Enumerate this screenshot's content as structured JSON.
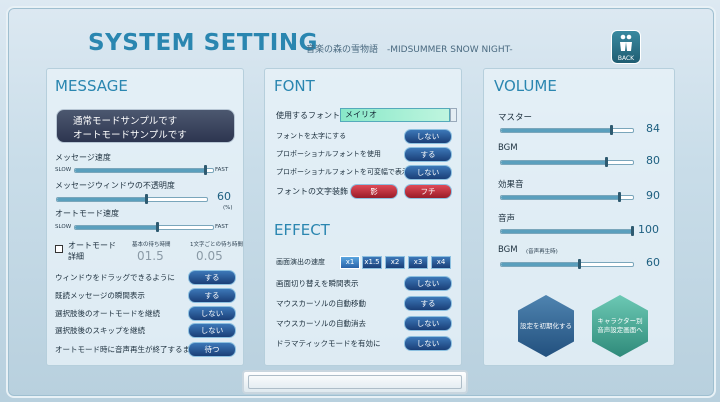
{
  "header": {
    "title": "SYSTEM SETTING",
    "subtitle": "音楽の森の雪物語　-MIDSUMMER SNOW NIGHT-",
    "back_label": "BACK"
  },
  "message": {
    "title": "MESSAGE",
    "sample_line1": "通常モードサンプルです",
    "sample_line2": "オートモードサンプルです",
    "message_speed_label": "メッセージ速度",
    "slow": "SLOW",
    "fast": "FAST",
    "message_speed_value": 0.95,
    "window_opacity_label": "メッセージウィンドウの不透明度",
    "window_opacity_value": "60",
    "window_opacity_unit": "(%)",
    "window_opacity_fraction": 0.6,
    "auto_speed_label": "オートモード速度",
    "auto_speed_value": 0.6,
    "auto_detail_label1": "オートモード",
    "auto_detail_label2": "詳細",
    "basic_wait_label": "基本の待ち時間",
    "char_wait_label": "1文字ごとの待ち時間",
    "basic_wait_value": "01.5",
    "char_wait_value": "0.05",
    "rows": [
      {
        "label": "ウィンドウをドラッグできるように",
        "button": "する"
      },
      {
        "label": "既読メッセージの瞬間表示",
        "button": "する"
      },
      {
        "label": "選択肢後のオートモードを継続",
        "button": "しない"
      },
      {
        "label": "選択肢後のスキップを継続",
        "button": "しない"
      },
      {
        "label": "オートモード時に音声再生が終了するまで",
        "button": "待つ"
      }
    ]
  },
  "font": {
    "title": "FONT",
    "use_font_label": "使用するフォント",
    "use_font_value": "メイリオ",
    "rows": [
      {
        "label": "フォントを太字にする",
        "button": "しない"
      },
      {
        "label": "プロポーショナルフォントを使用",
        "button": "する"
      },
      {
        "label": "プロポーショナルフォントを可変幅で表示",
        "button": "しない"
      }
    ],
    "decoration_label": "フォントの文字装飾",
    "decoration_shadow": "影",
    "decoration_outline": "フチ"
  },
  "effect": {
    "title": "EFFECT",
    "speed_label": "画面演出の速度",
    "speeds": [
      "x1",
      "x1.5",
      "x2",
      "x3",
      "x4"
    ],
    "rows": [
      {
        "label": "画面切り替えを瞬間表示",
        "button": "しない"
      },
      {
        "label": "マウスカーソルの自動移動",
        "button": "する"
      },
      {
        "label": "マウスカーソルの自動消去",
        "button": "しない"
      },
      {
        "label": "ドラマティックモードを有効に",
        "button": "しない"
      }
    ]
  },
  "volume": {
    "title": "VOLUME",
    "items": [
      {
        "label": "マスター",
        "value": "84",
        "level": 0.84
      },
      {
        "label": "BGM",
        "value": "80",
        "level": 0.8
      },
      {
        "label": "効果音",
        "value": "90",
        "level": 0.9
      },
      {
        "label": "音声",
        "value": "100",
        "level": 1.0
      },
      {
        "label": "BGM",
        "sublabel": "(音声再生時)",
        "value": "60",
        "level": 0.6
      }
    ],
    "reset_button": "設定を初期化する",
    "character_button_line1": "キャラクター別",
    "character_button_line2": "音声設定画面へ"
  },
  "colors": {
    "accent": "#2a86b0",
    "button_blue": "#1a3f78",
    "button_red": "#9a1c28",
    "font_select": "#88e8c8"
  }
}
